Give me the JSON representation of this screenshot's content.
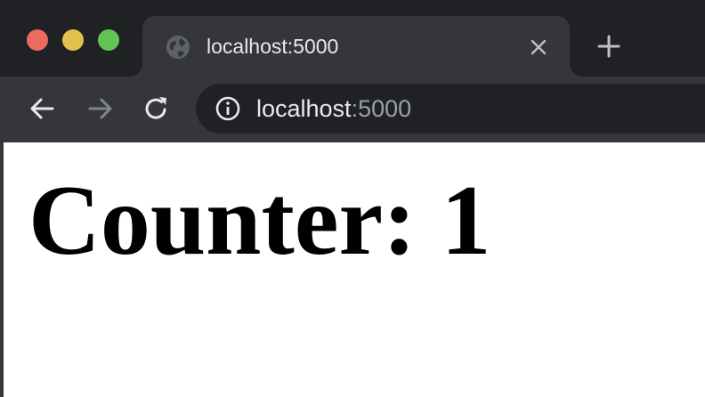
{
  "tab": {
    "title": "localhost:5000",
    "favicon": "globe-icon"
  },
  "toolbar": {
    "back_icon": "arrow-left-icon",
    "forward_icon": "arrow-right-icon",
    "reload_icon": "reload-icon"
  },
  "omnibox": {
    "security_icon": "info-icon",
    "url_host": "localhost",
    "url_port": ":5000"
  },
  "page": {
    "heading": "Counter: 1"
  },
  "colors": {
    "tabstrip_bg": "#202124",
    "tab_bg": "#35363a",
    "close_light": "#ed6a5e",
    "minimize_light": "#e5bf4e",
    "zoom_light": "#62c454",
    "text_primary": "#e8eaed",
    "text_dim": "#9aa0a6"
  }
}
